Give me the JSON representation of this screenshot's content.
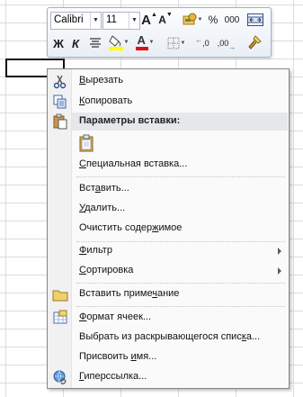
{
  "mini_toolbar": {
    "font_name": "Calibri",
    "font_size": "11",
    "grow_font_label": "A",
    "shrink_font_label": "A",
    "percent_label": "%",
    "thousands_label": "000",
    "bold_label": "Ж",
    "italic_label": "К",
    "font_color_label": "A",
    "inc_decimal_label": ",0",
    "dec_decimal_label": ",00",
    "fill_color": "#ffff00",
    "font_color": "#e01010"
  },
  "context_menu": {
    "items": [
      {
        "pre": "",
        "ul": "В",
        "post": "ырезать",
        "icon": "scissors-icon"
      },
      {
        "pre": "",
        "ul": "К",
        "post": "опировать",
        "icon": "copy-icon"
      },
      {
        "header": "Параметры вставки:"
      },
      {
        "pre": "",
        "ul": "С",
        "post": "пециальная вставка..."
      },
      {
        "pre": "Вст",
        "ul": "а",
        "post": "вить..."
      },
      {
        "pre": "",
        "ul": "У",
        "post": "далить..."
      },
      {
        "pre": "Очистить содер",
        "ul": "ж",
        "post": "имое"
      },
      {
        "pre": "",
        "ul": "Ф",
        "post": "ильтр",
        "submenu": true
      },
      {
        "pre": "",
        "ul": "С",
        "post": "ортировка",
        "submenu": true
      },
      {
        "pre": "Вставить приме",
        "ul": "ч",
        "post": "ание",
        "icon": "comment-icon"
      },
      {
        "pre": "",
        "ul": "Ф",
        "post": "ормат ячеек...",
        "icon": "format-cells-icon"
      },
      {
        "pre": "Выбрать из раскрывающегося спис",
        "ul": "к",
        "post": "а..."
      },
      {
        "pre": "Присвоить ",
        "ul": "и",
        "post": "мя..."
      },
      {
        "pre": "",
        "ul": "Г",
        "post": "иперссылка...",
        "icon": "hyperlink-icon"
      }
    ]
  }
}
